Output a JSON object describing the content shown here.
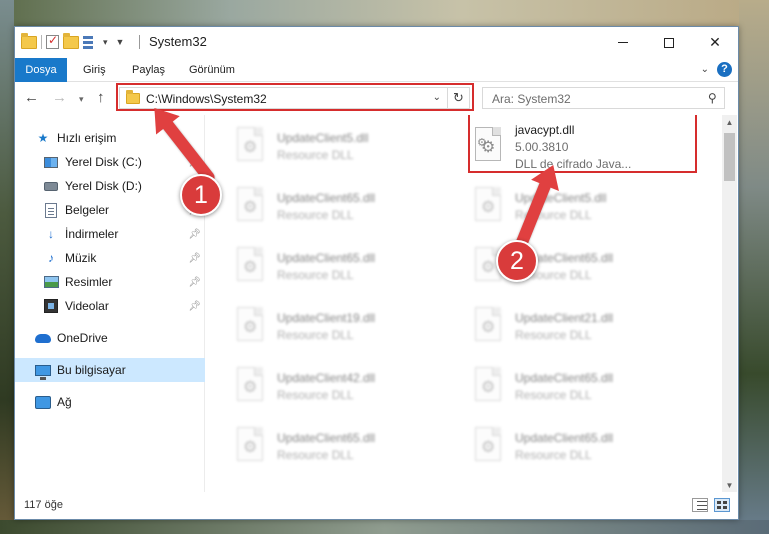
{
  "window": {
    "title": "System32"
  },
  "ribbon": {
    "tabs": [
      "Dosya",
      "Giriş",
      "Paylaş",
      "Görünüm"
    ]
  },
  "address": {
    "path": "C:\\Windows\\System32"
  },
  "search": {
    "placeholder": "Ara: System32"
  },
  "nav_pane": {
    "items": [
      {
        "label": "Hızlı erişim",
        "icon": "star-icon"
      },
      {
        "label": "Yerel Disk (C:)",
        "icon": "windows-drive-icon",
        "pinned": true
      },
      {
        "label": "Yerel Disk (D:)",
        "icon": "drive-icon"
      },
      {
        "label": "Belgeler",
        "icon": "document-icon",
        "pinned": true
      },
      {
        "label": "İndirmeler",
        "icon": "download-icon",
        "pinned": true
      },
      {
        "label": "Müzik",
        "icon": "music-icon",
        "pinned": true
      },
      {
        "label": "Resimler",
        "icon": "pictures-icon",
        "pinned": true
      },
      {
        "label": "Videolar",
        "icon": "video-icon",
        "pinned": true
      },
      {
        "label": "OneDrive",
        "icon": "onedrive-icon"
      },
      {
        "label": "Bu bilgisayar",
        "icon": "computer-icon",
        "selected": true
      },
      {
        "label": "Ağ",
        "icon": "network-icon"
      }
    ]
  },
  "files": {
    "highlighted": {
      "name": "javacypt.dll",
      "version": "5.00.3810",
      "description": "DLL de cifrado Java..."
    },
    "left_column": [
      {
        "name": "UpdateClient5.dll",
        "type": "Resource DLL"
      },
      {
        "name": "UpdateClient65.dll",
        "type": "Resource DLL"
      },
      {
        "name": "UpdateClient65.dll",
        "type": "Resource DLL"
      },
      {
        "name": "UpdateClient19.dll",
        "type": "Resource DLL"
      },
      {
        "name": "UpdateClient42.dll",
        "type": "Resource DLL"
      },
      {
        "name": "UpdateClient65.dll",
        "type": "Resource DLL"
      }
    ],
    "right_column": [
      {
        "name": "UpdateClient5.dll",
        "type": "Resource DLL"
      },
      {
        "name": "UpdateClient65.dll",
        "type": "Resource DLL"
      },
      {
        "name": "UpdateClient21.dll",
        "type": "Resource DLL"
      },
      {
        "name": "UpdateClient65.dll",
        "type": "Resource DLL"
      },
      {
        "name": "UpdateClient65.dll",
        "type": "Resource DLL"
      }
    ]
  },
  "status": {
    "item_count": "117 öğe"
  },
  "annotations": {
    "step1": "1",
    "step2": "2",
    "color": "#d62d2d"
  }
}
